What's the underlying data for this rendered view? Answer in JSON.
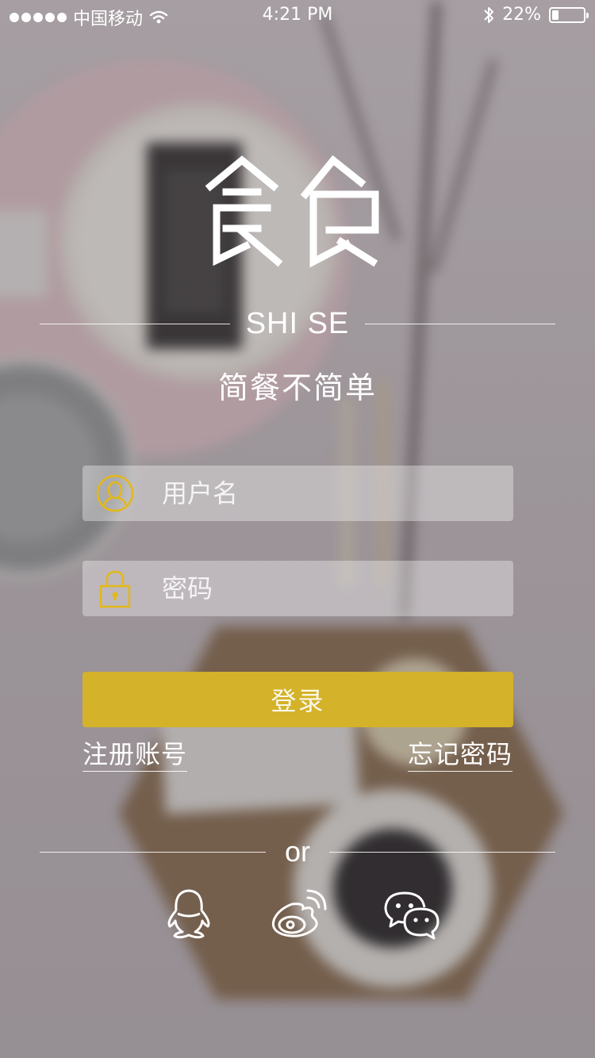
{
  "status_bar": {
    "carrier": "中国移动",
    "time": "4:21 PM",
    "battery": "22%",
    "battery_level": 0.22
  },
  "logo": {
    "brand": "SHI SE",
    "slogan": "简餐不简单"
  },
  "form": {
    "username_placeholder": "用户名",
    "password_placeholder": "密码",
    "username_icon": "user-avatar-icon",
    "password_icon": "padlock-icon",
    "login_label": "登录",
    "register_label": "注册账号",
    "forgot_label": "忘记密码"
  },
  "divider": {
    "or_text": "or"
  },
  "social": [
    {
      "name": "QQ",
      "icon": "qq-penguin-icon"
    },
    {
      "name": "Weibo",
      "icon": "weibo-icon"
    },
    {
      "name": "WeChat",
      "icon": "wechat-icon"
    }
  ],
  "colors": {
    "accent": "#d4b229",
    "icon_yellow": "#e3b818",
    "text": "#ffffff"
  }
}
